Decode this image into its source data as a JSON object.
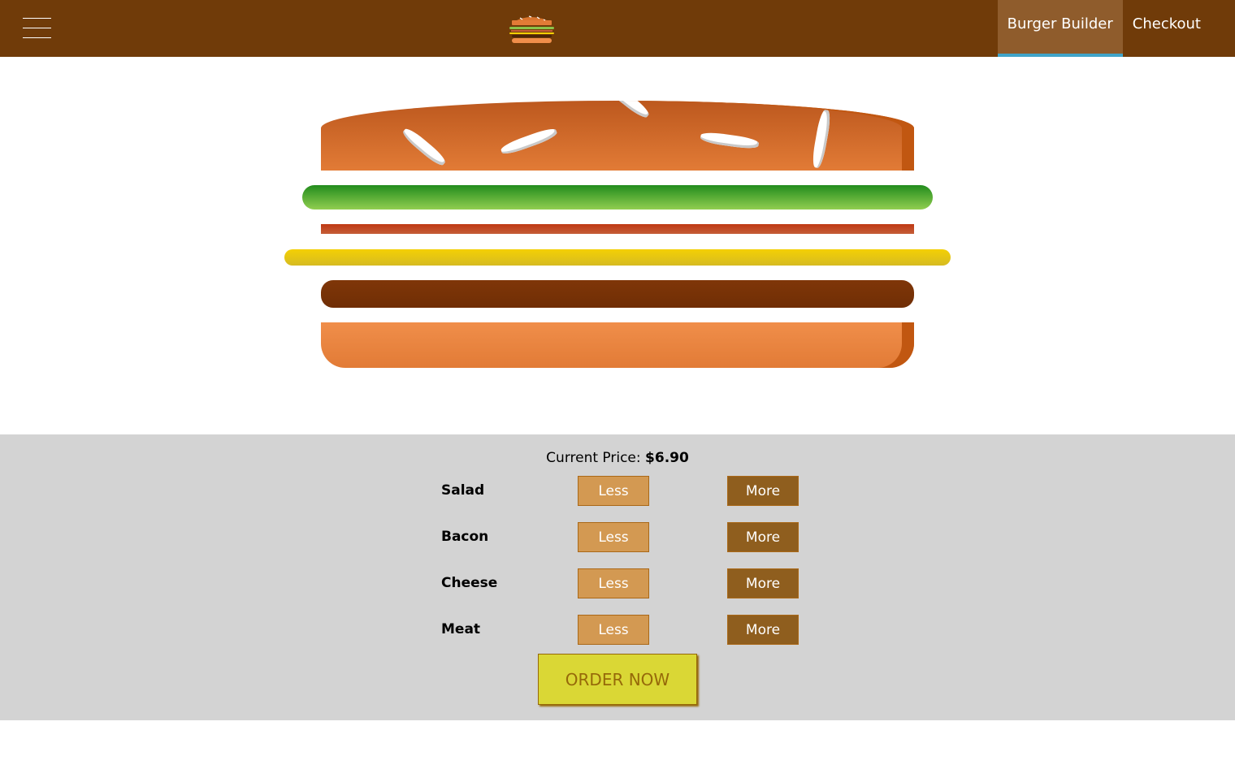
{
  "toolbar": {
    "menu_icon": "hamburger-menu-icon",
    "logo_icon": "burger-logo-icon",
    "nav": [
      {
        "label": "Burger Builder",
        "active": true
      },
      {
        "label": "Checkout",
        "active": false
      }
    ]
  },
  "burger": {
    "layers": [
      "bread-top",
      "salad",
      "bacon",
      "cheese",
      "meat",
      "bread-bottom"
    ]
  },
  "controls": {
    "price_label": "Current Price:",
    "price_value": "$6.90",
    "items": [
      {
        "label": "Salad",
        "less": "Less",
        "more": "More"
      },
      {
        "label": "Bacon",
        "less": "Less",
        "more": "More"
      },
      {
        "label": "Cheese",
        "less": "Less",
        "more": "More"
      },
      {
        "label": "Meat",
        "less": "Less",
        "more": "More"
      }
    ],
    "order_label": "ORDER NOW"
  },
  "colors": {
    "toolbar": "#703B09",
    "nav_active_bg": "#8F5C2C",
    "nav_active_border": "#40A4C8",
    "controls_bg": "#D3D3D3",
    "less_button": "#D39952",
    "more_button": "#8F5E1E",
    "order_button": "#DAD735"
  }
}
